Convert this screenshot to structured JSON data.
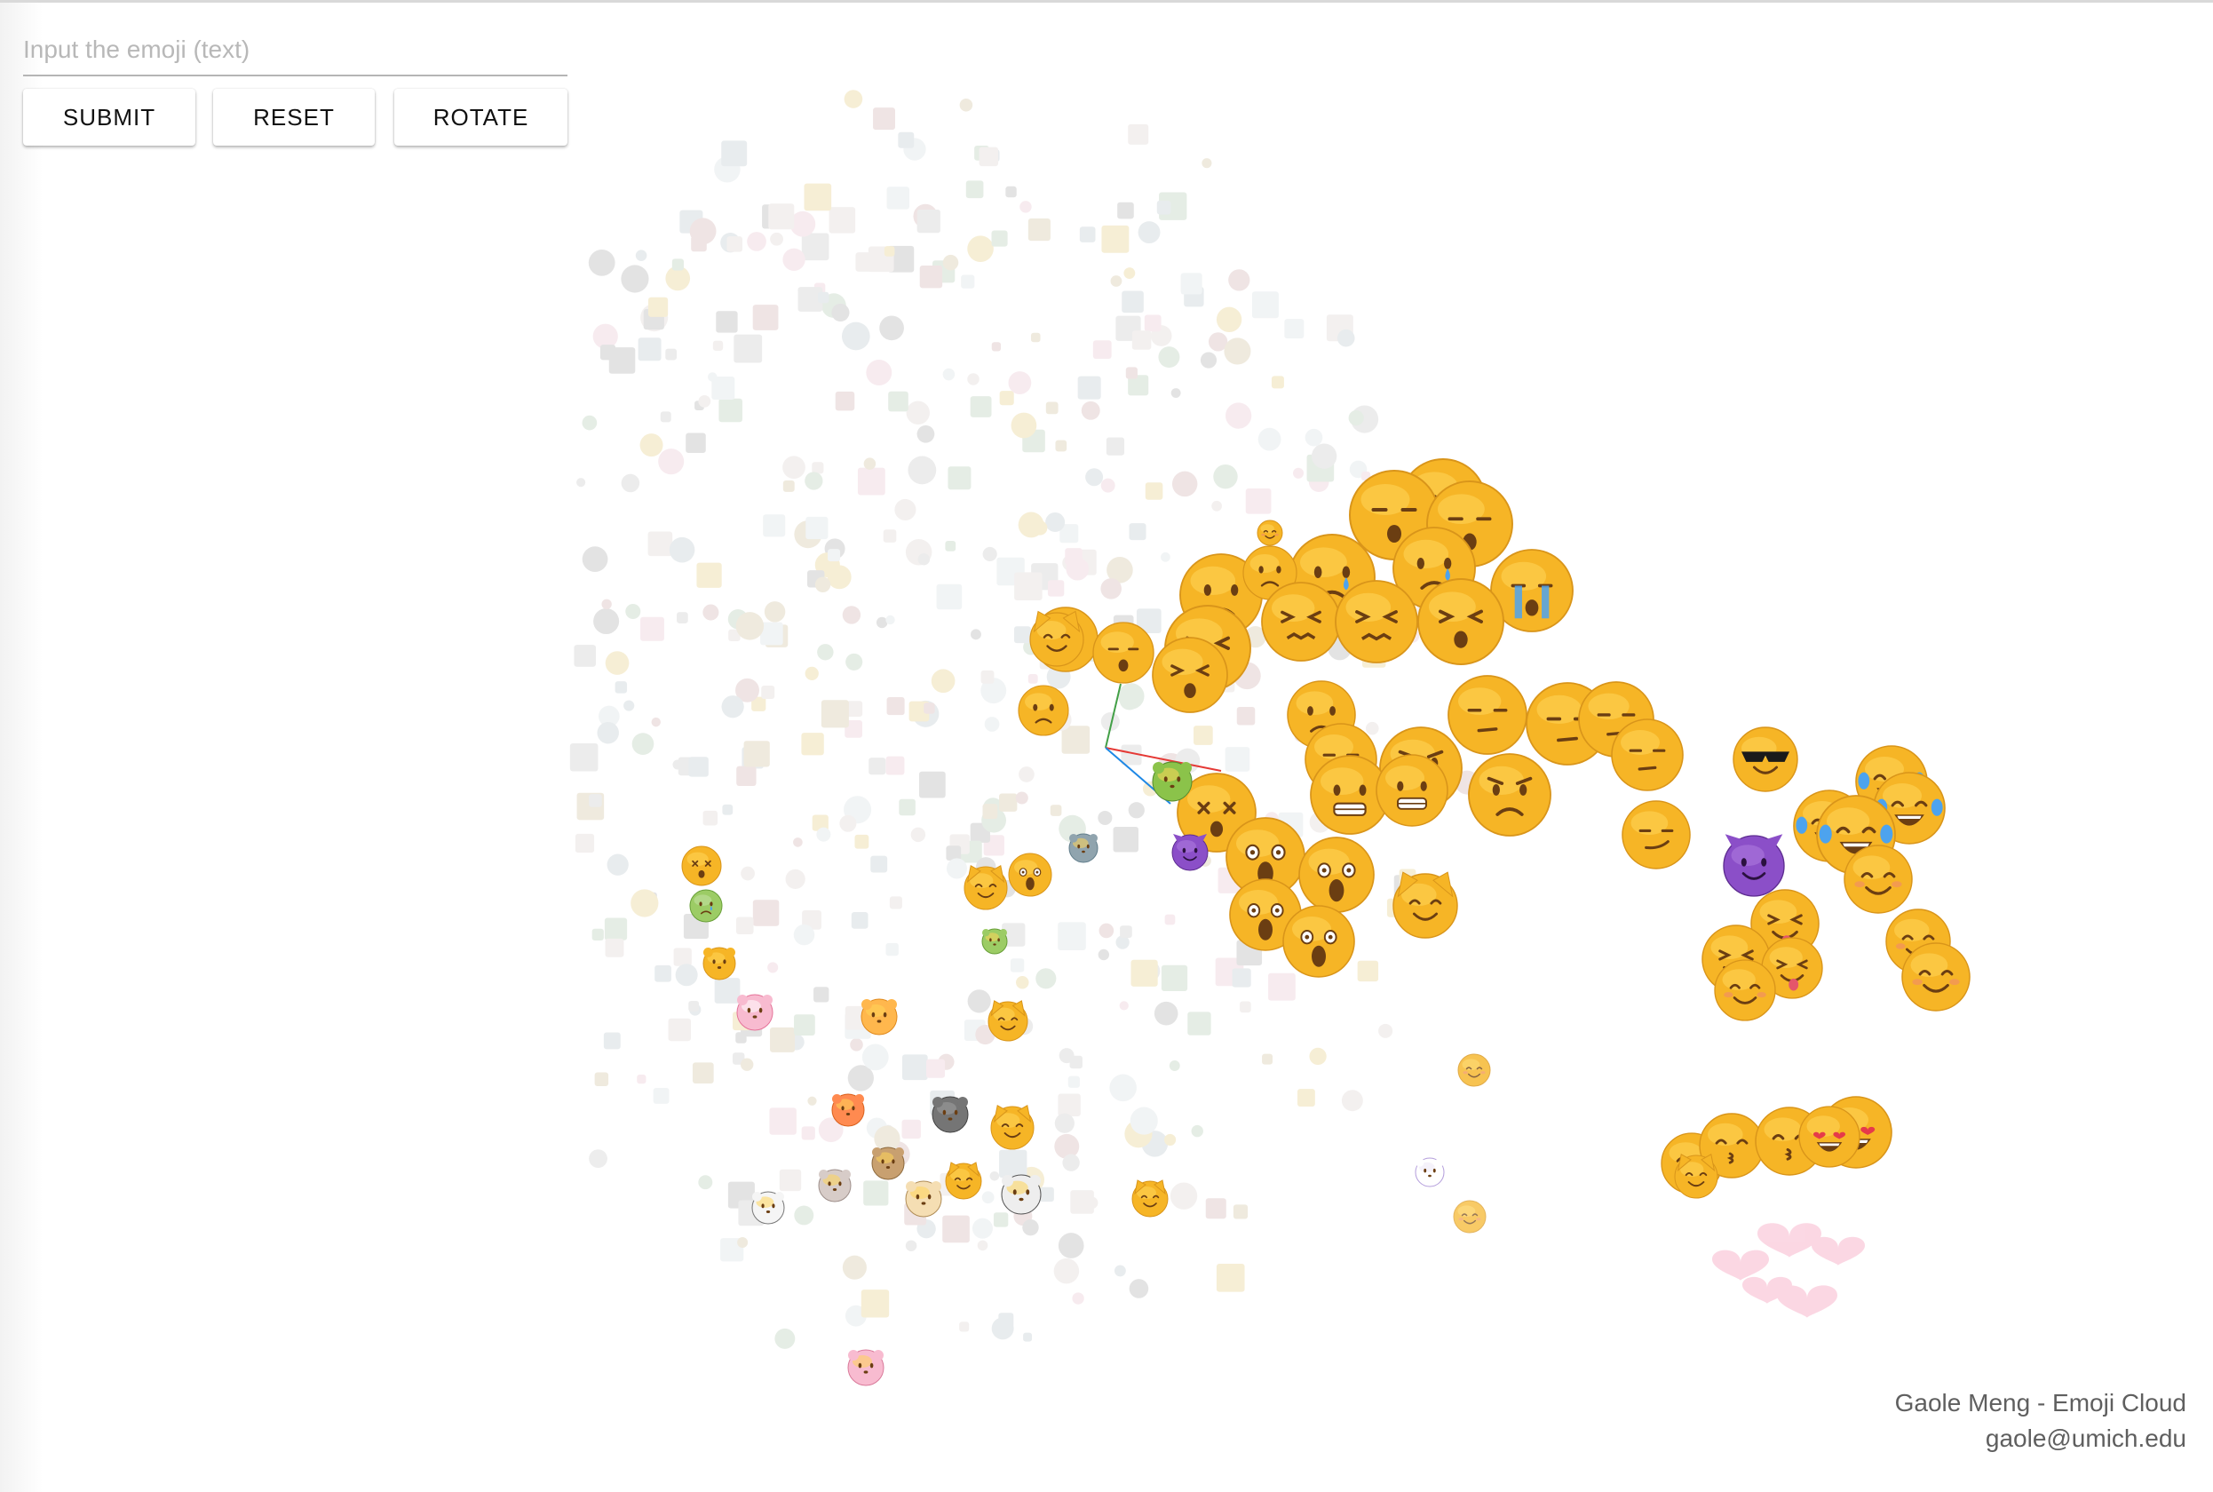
{
  "search": {
    "placeholder": "Input the emoji (text)",
    "value": ""
  },
  "buttons": {
    "submit": "SUBMIT",
    "reset": "RESET",
    "rotate": "ROTATE"
  },
  "credits": {
    "title": "Gaole Meng - Emoji Cloud",
    "email": "gaole@umich.edu"
  },
  "colors": {
    "emoji_face": "#f6b526",
    "emoji_face_light": "#ffd65a",
    "emoji_outline": "#d9951a",
    "emoji_feature": "#6b3e12",
    "tear": "#4da3ee",
    "devil": "#8b4fc8",
    "heart": "#e63a4a",
    "axis_x": "#e53935",
    "axis_y": "#43a047",
    "axis_z": "#1e88e5"
  },
  "icons": [
    "sleeping-face-emoji-icon",
    "crying-face-emoji-icon",
    "loudly-crying-face-emoji-icon",
    "tired-face-emoji-icon",
    "confounded-face-emoji-icon",
    "dizzy-face-emoji-icon",
    "grimacing-face-emoji-icon",
    "angry-face-emoji-icon",
    "unamused-face-emoji-icon",
    "smirking-face-emoji-icon",
    "sunglasses-face-emoji-icon",
    "smiling-devil-emoji-icon",
    "tears-of-joy-emoji-icon",
    "winking-tongue-emoji-icon",
    "smiling-face-emoji-icon",
    "heart-eyes-emoji-icon",
    "kissing-face-emoji-icon",
    "screaming-face-emoji-icon",
    "frowning-face-emoji-icon",
    "cat-face-emoji-icon",
    "animal-face-emoji-icon",
    "heart-emoji-icon"
  ]
}
